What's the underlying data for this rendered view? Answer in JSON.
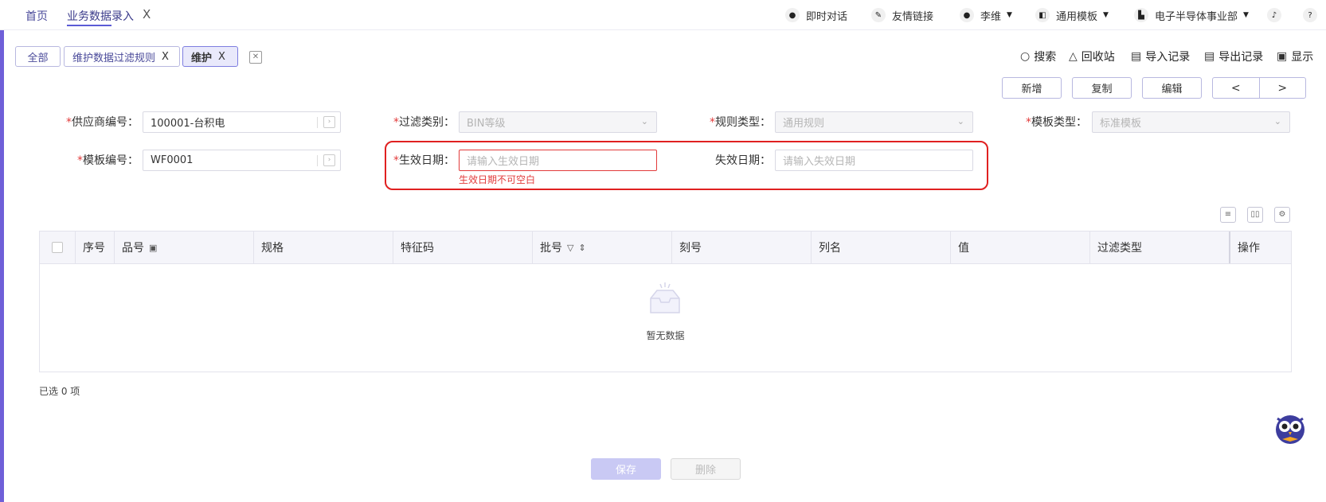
{
  "nav": {
    "home": "首页",
    "current_tab": "业务数据录入",
    "close": "X"
  },
  "topbar": {
    "chat": "即时对话",
    "links": "友情链接",
    "user": "李维",
    "template": "通用模板",
    "department": "电子半导体事业部"
  },
  "subtabs": {
    "all": "全部",
    "rules": "维护数据过滤规则",
    "maintain": "维护",
    "close": "X"
  },
  "actions": {
    "search": "搜索",
    "recycle": "回收站",
    "import_log": "导入记录",
    "export_log": "导出记录",
    "display": "显示"
  },
  "buttons": {
    "add": "新增",
    "copy": "复制",
    "edit": "编辑",
    "prev": "<",
    "next": ">",
    "save": "保存",
    "delete": "删除"
  },
  "form": {
    "supplier_label": "供应商编号：",
    "supplier_value": "100001-台积电",
    "filter_label": "过滤类别：",
    "filter_value": "BIN等级",
    "rule_label": "规则类型：",
    "rule_value": "通用规则",
    "template_type_label": "模板类型：",
    "template_type_value": "标准模板",
    "template_no_label": "模板编号：",
    "template_no_value": "WF0001",
    "effective_label": "生效日期：",
    "effective_placeholder": "请输入生效日期",
    "effective_error": "生效日期不可空白",
    "expire_label": "失效日期：",
    "expire_placeholder": "请输入失效日期",
    "required_mark": "*"
  },
  "table": {
    "columns": [
      "序号",
      "品号",
      "规格",
      "特征码",
      "批号",
      "刻号",
      "列名",
      "值",
      "过滤类型",
      "操作"
    ],
    "empty": "暂无数据",
    "selected": "已选 0 项"
  },
  "colors": {
    "accent": "#5b5bd6",
    "error": "#e23b3b",
    "highlight": "#e02020"
  }
}
